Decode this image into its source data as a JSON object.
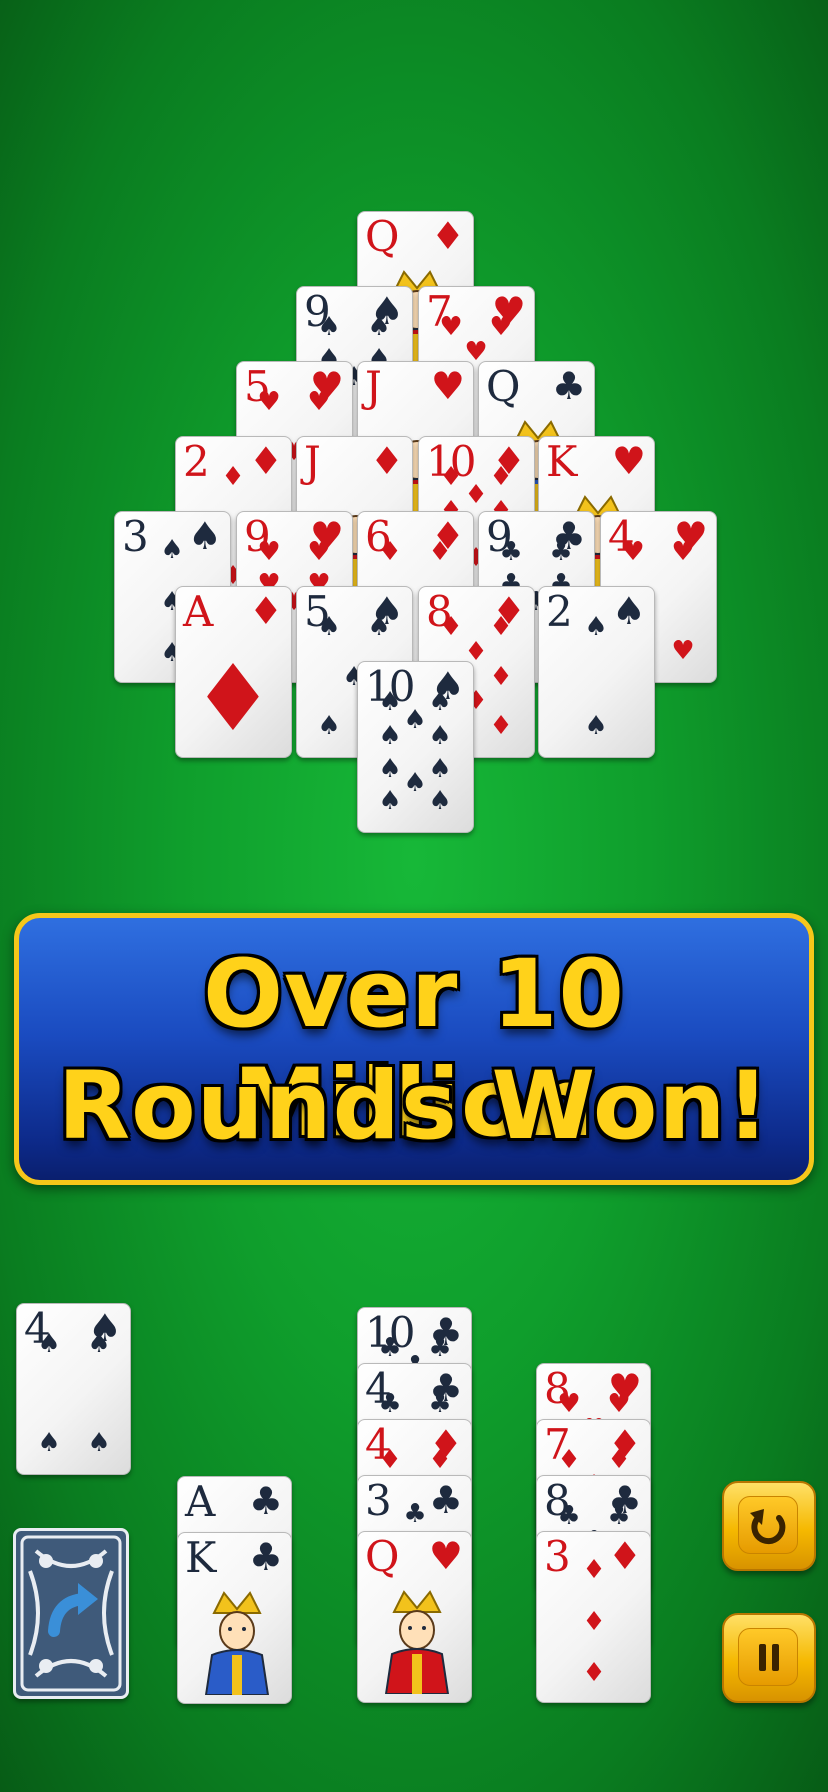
{
  "banner": {
    "line1": "Over 10 Million",
    "line2": "Rounds Won!"
  },
  "colors": {
    "felt": "#0f9e2c",
    "banner_fill": "#1a4bc0",
    "banner_border": "#f6c71a",
    "banner_text": "#ffd21a",
    "red_suit": "#d0141a",
    "black_suit": "#1e2a3e",
    "button": "#f5b800"
  },
  "pyramid": [
    {
      "rank": "Q",
      "suit": "diamond"
    },
    {
      "rank": "9",
      "suit": "spade"
    },
    {
      "rank": "7",
      "suit": "heart"
    },
    {
      "rank": "5",
      "suit": "heart"
    },
    {
      "rank": "J",
      "suit": "heart"
    },
    {
      "rank": "Q",
      "suit": "club"
    },
    {
      "rank": "2",
      "suit": "diamond"
    },
    {
      "rank": "J",
      "suit": "diamond"
    },
    {
      "rank": "10",
      "suit": "diamond"
    },
    {
      "rank": "K",
      "suit": "heart"
    },
    {
      "rank": "3",
      "suit": "spade"
    },
    {
      "rank": "9",
      "suit": "heart"
    },
    {
      "rank": "6",
      "suit": "diamond"
    },
    {
      "rank": "9",
      "suit": "club"
    },
    {
      "rank": "4",
      "suit": "heart"
    },
    {
      "rank": "A",
      "suit": "diamond"
    },
    {
      "rank": "5",
      "suit": "spade"
    },
    {
      "rank": "8",
      "suit": "diamond"
    },
    {
      "rank": "2",
      "suit": "spade"
    },
    {
      "rank": "10",
      "suit": "spade"
    }
  ],
  "waste_card": {
    "rank": "4",
    "suit": "spade"
  },
  "stock": {
    "icon": "undo-arrow-icon"
  },
  "piles": [
    [
      {
        "rank": "A",
        "suit": "club"
      },
      {
        "rank": "K",
        "suit": "club"
      }
    ],
    [
      {
        "rank": "10",
        "suit": "club"
      },
      {
        "rank": "4",
        "suit": "club"
      },
      {
        "rank": "4",
        "suit": "diamond"
      },
      {
        "rank": "3",
        "suit": "club"
      },
      {
        "rank": "Q",
        "suit": "heart"
      }
    ],
    [
      {
        "rank": "8",
        "suit": "heart"
      },
      {
        "rank": "7",
        "suit": "diamond"
      },
      {
        "rank": "8",
        "suit": "club"
      },
      {
        "rank": "3",
        "suit": "diamond"
      }
    ]
  ],
  "buttons": {
    "restart_icon": "restart-icon",
    "pause_icon": "pause-icon"
  }
}
